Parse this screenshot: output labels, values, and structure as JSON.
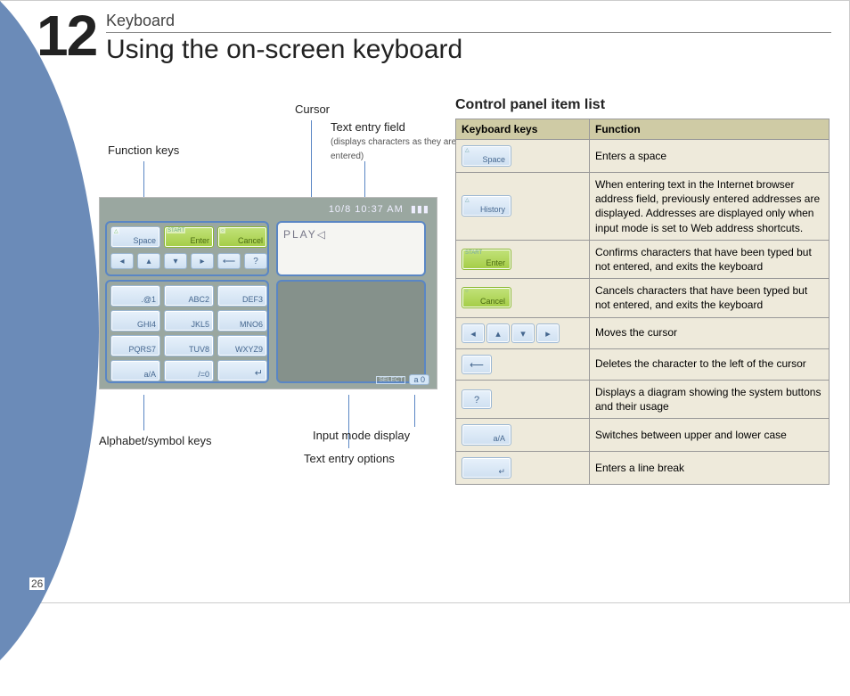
{
  "section": {
    "number": "12",
    "label": "Keyboard",
    "title": "Using the on-screen keyboard"
  },
  "page_number": "26",
  "callouts": {
    "function_keys": "Function keys",
    "cursor": "Cursor",
    "text_entry_field": "Text entry field",
    "text_entry_field_note": "(displays characters as they are entered)",
    "alphabet_keys": "Alphabet/symbol keys",
    "text_entry_options": "Text entry options",
    "input_mode_display": "Input mode display"
  },
  "psp": {
    "clock": "10/8 10:37 AM",
    "play_text": "PLAY",
    "keys": {
      "space": "Space",
      "enter": "Enter",
      "cancel": "Cancel",
      "r1": ".@1",
      "r2": "ABC2",
      "r3": "DEF3",
      "r4": "GHI4",
      "r5": "JKL5",
      "r6": "MNO6",
      "r7": "PQRS7",
      "r8": "TUV8",
      "r9": "WXYZ9",
      "aA": "a/A",
      "zero": "/=0"
    },
    "select_label": "SELECT",
    "mode_chip": "a 0",
    "badges": {
      "tri": "△",
      "start": "START",
      "circ": "○",
      "sq": "□"
    }
  },
  "control_panel": {
    "title": "Control panel item list",
    "headers": {
      "keys": "Keyboard keys",
      "fn": "Function"
    },
    "rows": [
      {
        "key_label": "Space",
        "key_style": "blue",
        "key_badge": "△",
        "fn": "Enters a space"
      },
      {
        "key_label": "History",
        "key_style": "blue",
        "key_badge": "△",
        "fn": "When entering text in the Internet browser address field, previously entered addresses are displayed. Addresses are displayed only when input mode is set to Web address shortcuts."
      },
      {
        "key_label": "Enter",
        "key_style": "green",
        "key_badge": "START",
        "fn": "Confirms characters that have been typed but not entered, and exits the keyboard"
      },
      {
        "key_label": "Cancel",
        "key_style": "green",
        "key_badge": "○",
        "fn": "Cancels characters that have been typed but not entered, and exits the keyboard"
      },
      {
        "key_label": "arrows",
        "key_style": "arrows",
        "fn": "Moves the cursor"
      },
      {
        "key_label": "backspace",
        "key_style": "backspace",
        "fn": "Deletes the character to the left of the cursor"
      },
      {
        "key_label": "?",
        "key_style": "help",
        "fn": "Displays a diagram showing the system buttons and their usage"
      },
      {
        "key_label": "a/A",
        "key_style": "blue",
        "fn": "Switches between upper and lower case"
      },
      {
        "key_label": "↵",
        "key_style": "linebreak",
        "fn": "Enters a line break"
      }
    ]
  }
}
